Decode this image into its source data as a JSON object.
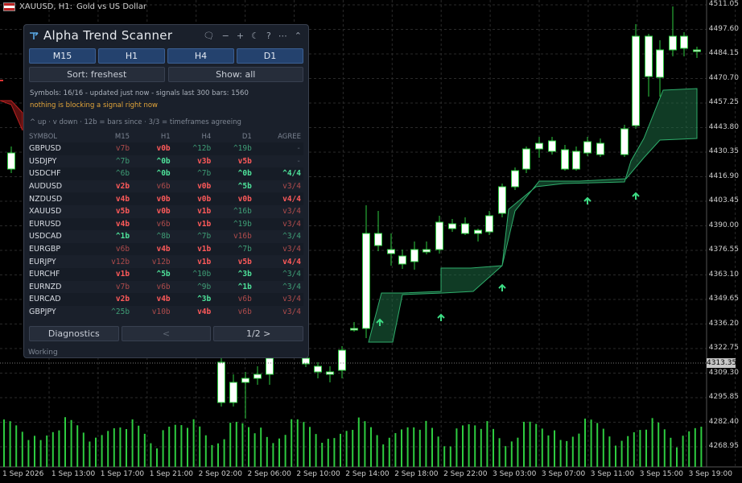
{
  "chart": {
    "flag": "us-flag-icon",
    "symbol": "XAUUSD, H1:",
    "description": "Gold vs US Dollar",
    "price_labels": [
      "4511.05",
      "4497.60",
      "4484.15",
      "4470.70",
      "4457.25",
      "4443.80",
      "4430.35",
      "4416.90",
      "4403.45",
      "4390.00",
      "4376.55",
      "4363.10",
      "4349.65",
      "4336.20",
      "4322.75",
      "4309.30",
      "4295.85",
      "4282.40",
      "4268.95"
    ],
    "current_price": "4313.35",
    "time_labels": [
      "1 Sep 2026",
      "1 Sep 13:00",
      "1 Sep 17:00",
      "1 Sep 21:00",
      "2 Sep 02:00",
      "2 Sep 06:00",
      "2 Sep 10:00",
      "2 Sep 14:00",
      "2 Sep 18:00",
      "2 Sep 22:00",
      "3 Sep 03:00",
      "3 Sep 07:00",
      "3 Sep 11:00",
      "3 Sep 15:00",
      "3 Sep 19:00"
    ],
    "colors": {
      "bull": "#ffffff",
      "bear": "#ffffff",
      "wick": "#2ecc40",
      "band": "#1d6b43",
      "arrow": "#3ddc84",
      "grid": "#2a2a2a"
    }
  },
  "panel": {
    "title": "Alpha Trend Scanner",
    "logo": "trend-logo-icon",
    "controls": [
      "chat-icon",
      "minimize-icon",
      "plus-icon",
      "moon-icon",
      "help-icon",
      "more-icon",
      "collapse-icon"
    ],
    "timeframes": [
      "M15",
      "H1",
      "H4",
      "D1"
    ],
    "sort_label": "Sort: freshest",
    "show_label": "Show: all",
    "status": "Symbols: 16/16 - updated just now - signals last 300 bars: 1560",
    "warning": "nothing is blocking a signal right now",
    "legend": "^ up  ·  v down  ·  12b = bars since  ·  3/3 = timeframes agreeing",
    "columns": [
      "SYMBOL",
      "M15",
      "H1",
      "H4",
      "D1",
      "AGREE"
    ],
    "rows": [
      {
        "symbol": "GBPUSD",
        "cells": [
          {
            "v": "v7b",
            "s": "dn-dim"
          },
          {
            "v": "v0b",
            "s": "dn-bold"
          },
          {
            "v": "^12b",
            "s": "up-dim"
          },
          {
            "v": "^19b",
            "s": "up-dim"
          },
          {
            "v": "-",
            "s": "neutral"
          }
        ]
      },
      {
        "symbol": "USDJPY",
        "cells": [
          {
            "v": "^7b",
            "s": "up-dim"
          },
          {
            "v": "^0b",
            "s": "up-bold"
          },
          {
            "v": "v3b",
            "s": "dn-bold"
          },
          {
            "v": "v5b",
            "s": "dn-bold"
          },
          {
            "v": "-",
            "s": "neutral"
          }
        ]
      },
      {
        "symbol": "USDCHF",
        "cells": [
          {
            "v": "^6b",
            "s": "up-dim"
          },
          {
            "v": "^0b",
            "s": "up-bold"
          },
          {
            "v": "^7b",
            "s": "up-dim"
          },
          {
            "v": "^0b",
            "s": "up-bold"
          },
          {
            "v": "^4/4",
            "s": "up-bold"
          }
        ]
      },
      {
        "symbol": "AUDUSD",
        "cells": [
          {
            "v": "v2b",
            "s": "dn-bold"
          },
          {
            "v": "v6b",
            "s": "dn-dim"
          },
          {
            "v": "v0b",
            "s": "dn-bold"
          },
          {
            "v": "^5b",
            "s": "up-bold"
          },
          {
            "v": "v3/4",
            "s": "dn-dim"
          }
        ]
      },
      {
        "symbol": "NZDUSD",
        "cells": [
          {
            "v": "v4b",
            "s": "dn-bold"
          },
          {
            "v": "v0b",
            "s": "dn-bold"
          },
          {
            "v": "v0b",
            "s": "dn-bold"
          },
          {
            "v": "v0b",
            "s": "dn-bold"
          },
          {
            "v": "v4/4",
            "s": "dn-bold"
          }
        ]
      },
      {
        "symbol": "XAUUSD",
        "cells": [
          {
            "v": "v5b",
            "s": "dn-bold"
          },
          {
            "v": "v0b",
            "s": "dn-bold"
          },
          {
            "v": "v1b",
            "s": "dn-bold"
          },
          {
            "v": "^16b",
            "s": "up-dim"
          },
          {
            "v": "v3/4",
            "s": "dn-dim"
          }
        ]
      },
      {
        "symbol": "EURUSD",
        "cells": [
          {
            "v": "v4b",
            "s": "dn-bold"
          },
          {
            "v": "v6b",
            "s": "dn-dim"
          },
          {
            "v": "v1b",
            "s": "dn-bold"
          },
          {
            "v": "^19b",
            "s": "up-dim"
          },
          {
            "v": "v3/4",
            "s": "dn-dim"
          }
        ]
      },
      {
        "symbol": "USDCAD",
        "cells": [
          {
            "v": "^1b",
            "s": "up-bold"
          },
          {
            "v": "^8b",
            "s": "up-dim"
          },
          {
            "v": "^7b",
            "s": "up-dim"
          },
          {
            "v": "v16b",
            "s": "dn-dim"
          },
          {
            "v": "^3/4",
            "s": "up-dim"
          }
        ]
      },
      {
        "symbol": "EURGBP",
        "cells": [
          {
            "v": "v6b",
            "s": "dn-dim"
          },
          {
            "v": "v4b",
            "s": "dn-bold"
          },
          {
            "v": "v1b",
            "s": "dn-bold"
          },
          {
            "v": "^7b",
            "s": "up-dim"
          },
          {
            "v": "v3/4",
            "s": "dn-dim"
          }
        ]
      },
      {
        "symbol": "EURJPY",
        "cells": [
          {
            "v": "v12b",
            "s": "dn-dim"
          },
          {
            "v": "v12b",
            "s": "dn-dim"
          },
          {
            "v": "v1b",
            "s": "dn-bold"
          },
          {
            "v": "v5b",
            "s": "dn-bold"
          },
          {
            "v": "v4/4",
            "s": "dn-bold"
          }
        ]
      },
      {
        "symbol": "EURCHF",
        "cells": [
          {
            "v": "v1b",
            "s": "dn-bold"
          },
          {
            "v": "^5b",
            "s": "up-bold"
          },
          {
            "v": "^10b",
            "s": "up-dim"
          },
          {
            "v": "^3b",
            "s": "up-bold"
          },
          {
            "v": "^3/4",
            "s": "up-dim"
          }
        ]
      },
      {
        "symbol": "EURNZD",
        "cells": [
          {
            "v": "v7b",
            "s": "dn-dim"
          },
          {
            "v": "v6b",
            "s": "dn-dim"
          },
          {
            "v": "^9b",
            "s": "up-dim"
          },
          {
            "v": "^1b",
            "s": "up-bold"
          },
          {
            "v": "^3/4",
            "s": "up-dim"
          }
        ]
      },
      {
        "symbol": "EURCAD",
        "cells": [
          {
            "v": "v2b",
            "s": "dn-bold"
          },
          {
            "v": "v4b",
            "s": "dn-bold"
          },
          {
            "v": "^3b",
            "s": "up-bold"
          },
          {
            "v": "v6b",
            "s": "dn-dim"
          },
          {
            "v": "v3/4",
            "s": "dn-dim"
          }
        ]
      },
      {
        "symbol": "GBPJPY",
        "cells": [
          {
            "v": "^25b",
            "s": "up-dim"
          },
          {
            "v": "v10b",
            "s": "dn-dim"
          },
          {
            "v": "v4b",
            "s": "dn-bold"
          },
          {
            "v": "v6b",
            "s": "dn-dim"
          },
          {
            "v": "v3/4",
            "s": "dn-dim"
          }
        ]
      }
    ],
    "diagnostics_label": "Diagnostics",
    "prev_label": "<",
    "page_label": "1/2 >",
    "footer_status": "Working"
  }
}
